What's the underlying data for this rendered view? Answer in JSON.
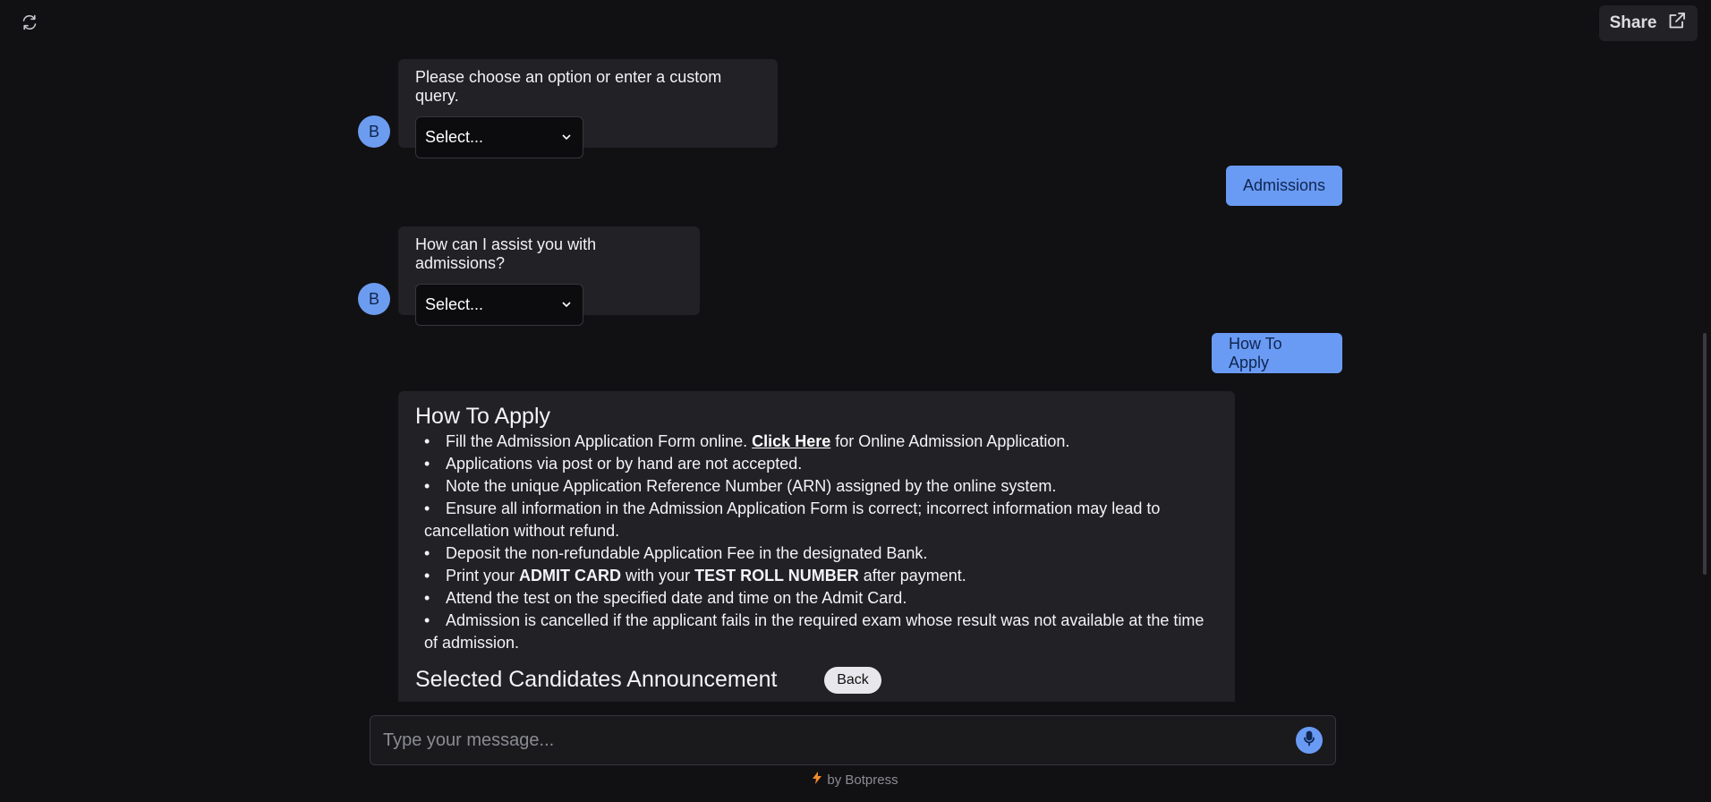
{
  "header": {
    "share_label": "Share"
  },
  "messages": {
    "bot1": {
      "avatar": "B",
      "text": "Please choose an option or enter a custom query.",
      "select_value": "Select..."
    },
    "user1": {
      "text": "Admissions"
    },
    "bot2": {
      "avatar": "B",
      "text": "How can I assist you with admissions?",
      "select_value": "Select..."
    },
    "user2": {
      "text": "How To Apply"
    }
  },
  "card": {
    "title": "How To Apply",
    "items": [
      {
        "pre": "Fill the Admission Application Form online. ",
        "link": "Click Here",
        "post": " for Online Admission Application."
      },
      {
        "text": "Applications via post or by hand are not accepted."
      },
      {
        "text": "Note the unique Application Reference Number (ARN) assigned by the online system."
      },
      {
        "text": "Ensure all information in the Admission Application Form is correct; incorrect information may lead to cancellation without refund."
      },
      {
        "text": "Deposit the non-refundable Application Fee in the designated Bank."
      },
      {
        "pre": "Print your ",
        "bold1": "ADMIT CARD",
        "mid": " with your ",
        "bold2": "TEST ROLL NUMBER",
        "post": " after payment."
      },
      {
        "text": "Attend the test on the specified date and time on the Admit Card."
      },
      {
        "text": "Admission is cancelled if the applicant fails in the required exam whose result was not available at the time of admission."
      }
    ],
    "subtitle": "Selected Candidates Announcement",
    "back_label": "Back"
  },
  "composer": {
    "placeholder": "Type your message..."
  },
  "footer": {
    "powered_by": "by Botpress"
  },
  "colors": {
    "accent": "#6a9bf4",
    "background": "#111113",
    "bubble": "#212126",
    "bolt": "#f08a2c"
  },
  "icons": [
    "refresh-icon",
    "external-link-icon",
    "chevron-down-icon",
    "microphone-icon",
    "lightning-icon"
  ]
}
